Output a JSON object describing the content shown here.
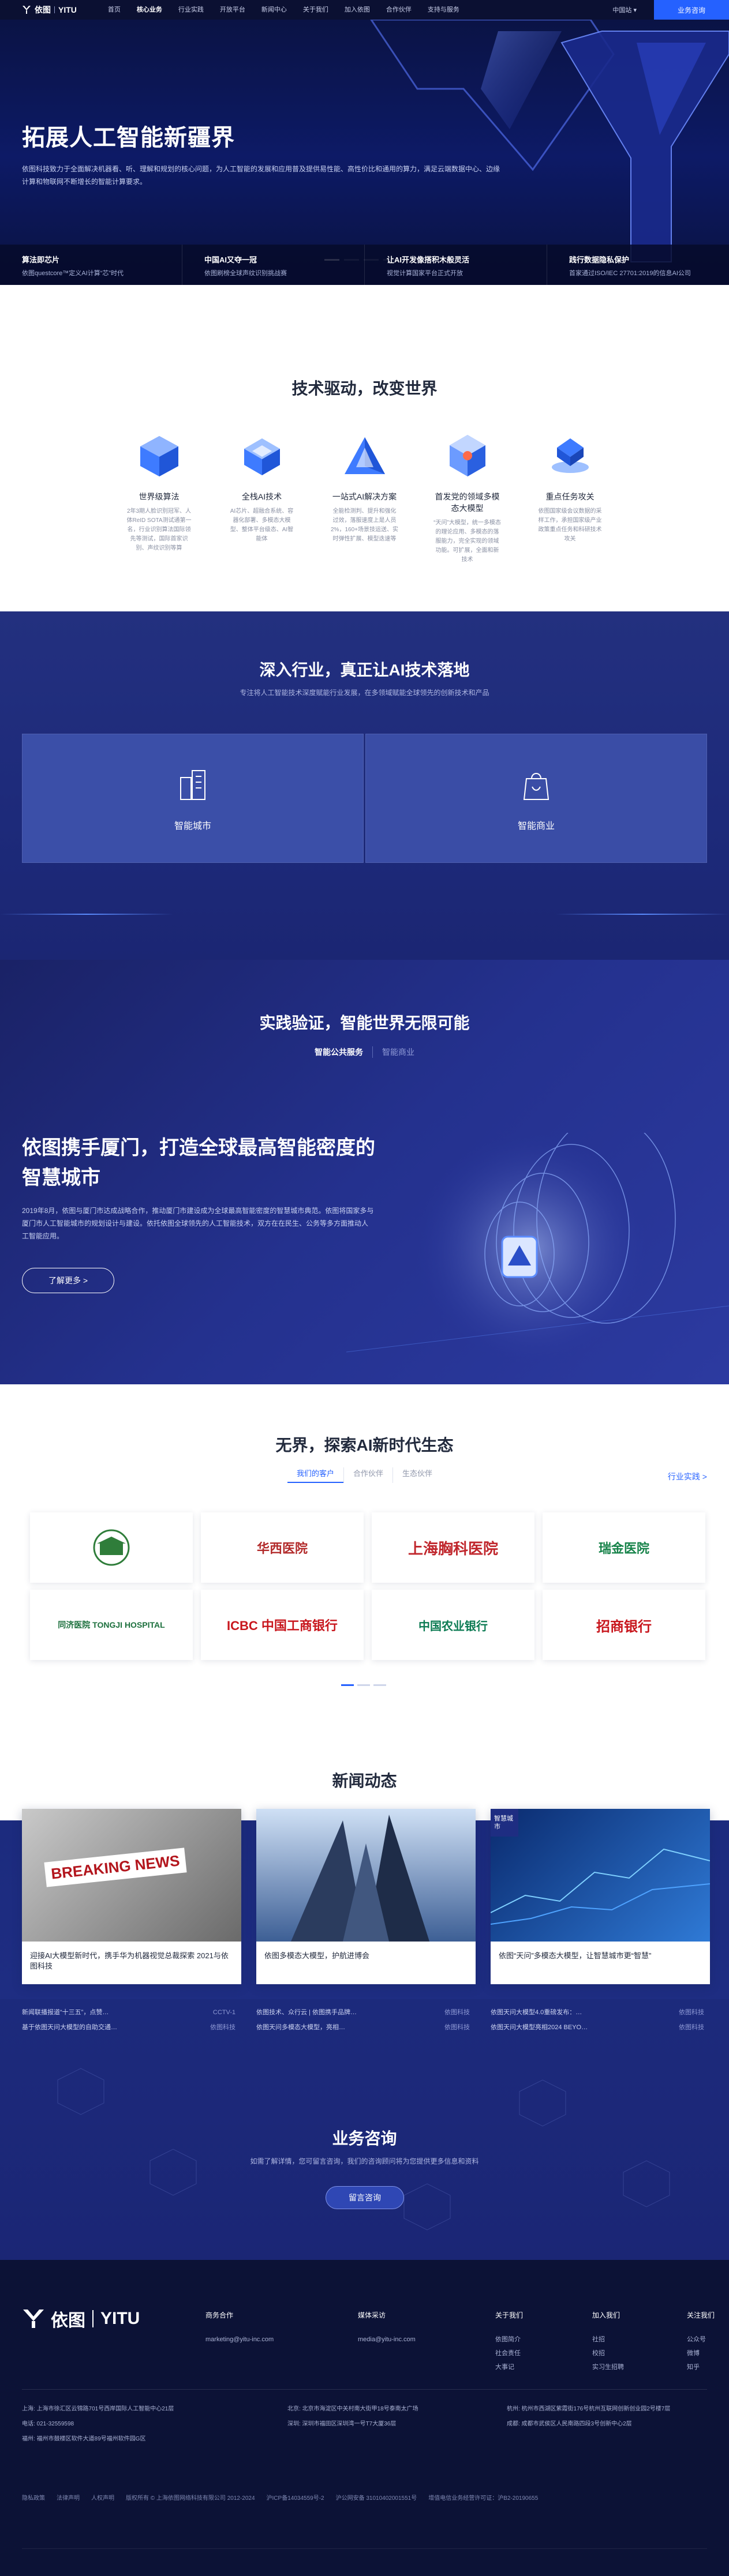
{
  "header": {
    "brand": "依图",
    "brand_en": "YITU",
    "nav": [
      "首页",
      "核心业务",
      "行业实践",
      "开放平台",
      "新闻中心",
      "关于我们",
      "加入依图",
      "合作伙伴",
      "支持与服务"
    ],
    "lang": "中国站",
    "consult": "业务咨询"
  },
  "hero": {
    "title": "拓展人工智能新疆界",
    "desc": "依图科技致力于全面解决机器看、听、理解和规划的核心问题，为人工智能的发展和应用普及提供易性能、高性价比和通用的算力，满足云端数据中心、边缘计算和物联网不断增长的智能计算要求。",
    "highlights": [
      {
        "title": "算法即芯片",
        "sub": "依图questcore™定义AI计算“芯”时代"
      },
      {
        "title": "中国AI又夺一冠",
        "sub": "依图刷榜全球声纹识别挑战赛"
      },
      {
        "title": "让AI开发像搭积木般灵活",
        "sub": "视觉计算国家平台正式开放"
      },
      {
        "title": "践行数据隐私保护",
        "sub": "首家通过ISO/IEC 27701:2019的信息AI公司"
      }
    ]
  },
  "tech": {
    "title": "技术驱动，改变世界",
    "items": [
      {
        "name": "世界级算法",
        "desc": "2年3期人脸识别冠军、人体ReID SOTA测试通第一名，行业识别算法国际领先等测试，国际首家识别、声纹识别等算"
      },
      {
        "name": "全栈AI技术",
        "desc": "AI芯片、超融合系统、容器化部署、多模态大模型、整体平台级态、AI智能体"
      },
      {
        "name": "一站式AI解决方案",
        "desc": "全能检测判、提升和强化过效，落服速度上是人员2%，160+场景技运送、实时弹性扩展、模型迭速等"
      },
      {
        "name": "首发党的领域多模态大模型",
        "desc": "“天问”大模型，统一多模态的理论应用、多模态的落服能力，完全实现的领域功能。可扩展，全面和新技术"
      },
      {
        "name": "重点任务攻关",
        "desc": "依图国家级会议数据的采样工作，承担国家级产业政策重点任务和科研技术攻关"
      }
    ]
  },
  "industry": {
    "title": "深入行业，真正让AI技术落地",
    "sub": "专注将人工智能技术深度赋能行业发展，在多领域赋能全球领先的创新技术和产品",
    "panels": [
      "智能城市",
      "智能商业"
    ]
  },
  "practice": {
    "title": "实践验证，智能世界无限可能",
    "tabs": [
      "智能公共服务",
      "智能商业"
    ],
    "case_title": "依图携手厦门，打造全球最高智能密度的智慧城市",
    "case_desc": "2019年8月，依图与厦门市达成战略合作，推动厦门市建设成为全球最高智能密度的智慧城市典范。依图将国家多与厦门市人工智能城市的规划设计与建设。依托依图全球领先的人工智能技术，双方在在民生、公务等多方面推动人工智能应用。",
    "more": "了解更多 >"
  },
  "eco": {
    "title": "无界，探索AI新时代生态",
    "tabs": [
      "我们的客户",
      "合作伙伴",
      "生态伙伴"
    ],
    "link": "行业实践 >",
    "logos": [
      "高校",
      "华西医院",
      "上海胸科医院",
      "瑞金医院",
      "同济医院 TONGJI HOSPITAL",
      "ICBC 中国工商银行",
      "中国农业银行",
      "招商银行"
    ]
  },
  "news": {
    "title": "新闻动态",
    "cards": [
      {
        "caption": "迎接AI大模型新时代，携手华为机器视觉总裁探索 2021与依图科技",
        "tag": ""
      },
      {
        "caption": "依图多模态大模型，护航进博会",
        "tag": ""
      },
      {
        "caption": "依图“天问”多模态大模型，让智慧城市更“智慧”",
        "tag": "智慧城市"
      }
    ],
    "list": [
      [
        [
          "新闻联播报道“十三五”，点赞…",
          "CCTV-1"
        ],
        [
          "基于依图天问大模型的自助交通…",
          "依图科技"
        ]
      ],
      [
        [
          "依图技术、众行云 | 依图携手品牌…",
          "依图科技"
        ],
        [
          "依图天问多模态大模型，亮相…",
          "依图科技"
        ]
      ],
      [
        [
          "依图天问大模型4.0重磅发布：…",
          "依图科技"
        ],
        [
          "依图天问大模型亮相2024 BEYO…",
          "依图科技"
        ]
      ]
    ]
  },
  "consult": {
    "title": "业务咨询",
    "sub": "如需了解详情，您可留言咨询，我们的咨询顾问将为您提供更多信息和资料",
    "btn": "留言咨询"
  },
  "footer": {
    "cols": [
      {
        "h": "商务合作",
        "items": [
          "marketing@yitu-inc.com"
        ]
      },
      {
        "h": "媒体采访",
        "items": [
          "media@yitu-inc.com"
        ]
      },
      {
        "h": "关于我们",
        "items": [
          "依图简介",
          "社会责任",
          "大事记"
        ]
      },
      {
        "h": "加入我们",
        "items": [
          "社招",
          "校招",
          "实习生招聘"
        ]
      },
      {
        "h": "关注我们",
        "items": [
          "公众号",
          "微博",
          "知乎"
        ]
      }
    ],
    "offices": [
      [
        "上海: 上海市徐汇区云锦路701号西岸国际人工智能中心21层",
        "北京: 北京市海淀区中关村南大街甲18号泰南太广场",
        "杭州: 杭州市西湖区紫霞街176号杭州互联网创新创业园2号楼7层"
      ],
      [
        "电话: 021-32559598",
        "深圳: 深圳市福田区深圳湾一号T7大厦36层",
        "成都: 成都市武侯区人民南路四段3号创新中心2层"
      ],
      [
        "福州: 福州市鼓楼区软件大道89号福州软件园G区"
      ]
    ],
    "bottom": [
      "隐私政策",
      "法律声明",
      "人权声明",
      "版权所有 © 上海依图网络科技有限公司 2012-2024",
      "沪ICP备14034559号-2",
      "沪公网安备 31010402001551号",
      "增值电信业务经营许可证：沪B2-20190655"
    ]
  },
  "colors": {
    "accent": "#2561ff",
    "dark_navy": "#0b1032",
    "section_blue": "#23307f"
  }
}
